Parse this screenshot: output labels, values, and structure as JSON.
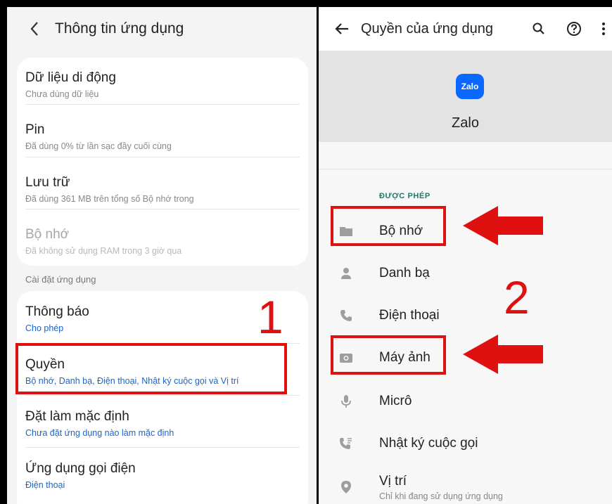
{
  "left": {
    "title": "Thông tin ứng dụng",
    "items_top": [
      {
        "title": "Dữ liệu di động",
        "subtitle": "Chưa dùng dữ liệu"
      },
      {
        "title": "Pin",
        "subtitle": "Đã dùng 0% từ lần sạc đầy cuối cùng"
      },
      {
        "title": "Lưu trữ",
        "subtitle": "Đã dùng 361 MB trên tổng số Bộ nhớ trong"
      },
      {
        "title": "Bộ nhớ",
        "subtitle": "Đã không sử dụng RAM trong 3 giờ qua"
      }
    ],
    "section_label": "Cài đặt ứng dụng",
    "items_bottom": [
      {
        "title": "Thông báo",
        "subtitle": "Cho phép"
      },
      {
        "title": "Quyền",
        "subtitle": "Bộ nhớ, Danh bạ, Điện thoại, Nhật ký cuộc gọi và Vị trí"
      },
      {
        "title": "Đặt làm mặc định",
        "subtitle": "Chưa đặt ứng dụng nào làm mặc định"
      },
      {
        "title": "Ứng dụng gọi điện",
        "subtitle": "Điện thoại"
      }
    ]
  },
  "right": {
    "title": "Quyền của ứng dụng",
    "app_logo_text": "Zalo",
    "app_name": "Zalo",
    "section_label": "ĐƯỢC PHÉP",
    "permissions": [
      {
        "label": "Bộ nhớ",
        "icon": "folder-icon"
      },
      {
        "label": "Danh bạ",
        "icon": "contacts-icon"
      },
      {
        "label": "Điện thoại",
        "icon": "phone-icon"
      },
      {
        "label": "Máy ảnh",
        "icon": "camera-icon"
      },
      {
        "label": "Micrô",
        "icon": "microphone-icon"
      },
      {
        "label": "Nhật ký cuộc gọi",
        "icon": "call-log-icon"
      },
      {
        "label": "Vị trí",
        "icon": "location-icon",
        "subtitle": "Chỉ khi đang sử dụng ứng dụng"
      }
    ]
  },
  "annotations": {
    "step1": "1",
    "step2": "2",
    "color": "#e01010"
  },
  "colors": {
    "link_blue": "#1a66c8",
    "allowed_green": "#1a7a6a",
    "zalo_blue": "#0a68ff"
  }
}
